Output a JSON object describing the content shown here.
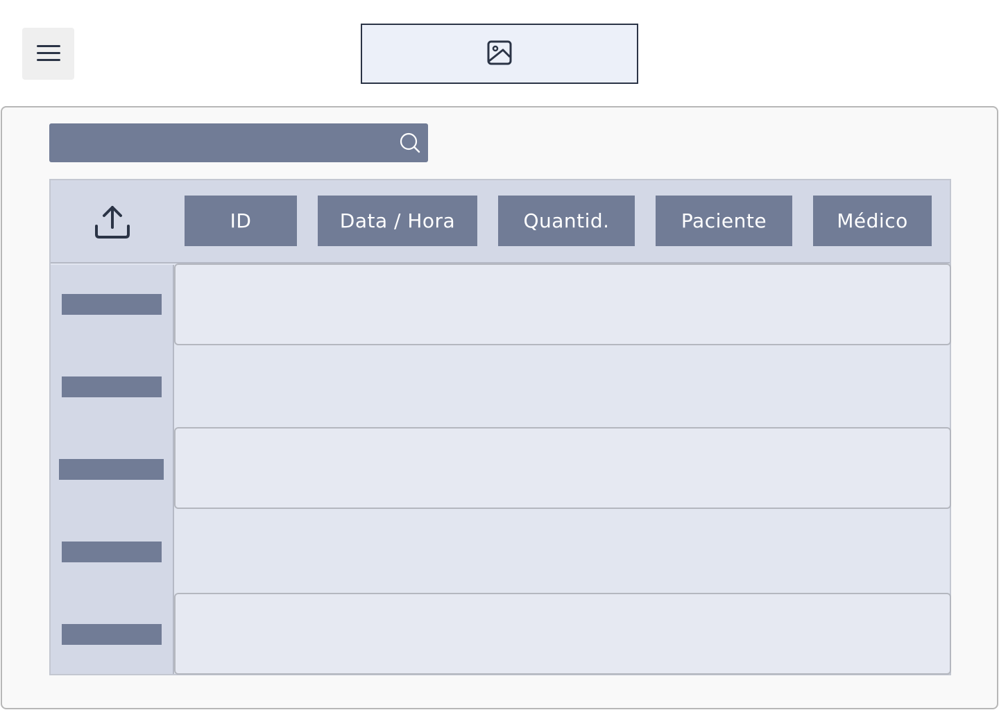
{
  "header": {
    "menu_icon": "hamburger-menu-icon",
    "logo_icon": "image-placeholder-icon"
  },
  "search": {
    "value": "",
    "placeholder": "",
    "icon": "search-icon"
  },
  "table": {
    "upload_icon": "upload-icon",
    "columns": [
      "ID",
      "Data / Hora",
      "Quantid.",
      "Paciente",
      "Médico"
    ]
  },
  "colors": {
    "accent": "#717c96",
    "header_bg": "#d3d8e6",
    "row_bg": "#e6e9f2",
    "logo_bg": "#ecf0f9",
    "dark": "#2b3446"
  }
}
